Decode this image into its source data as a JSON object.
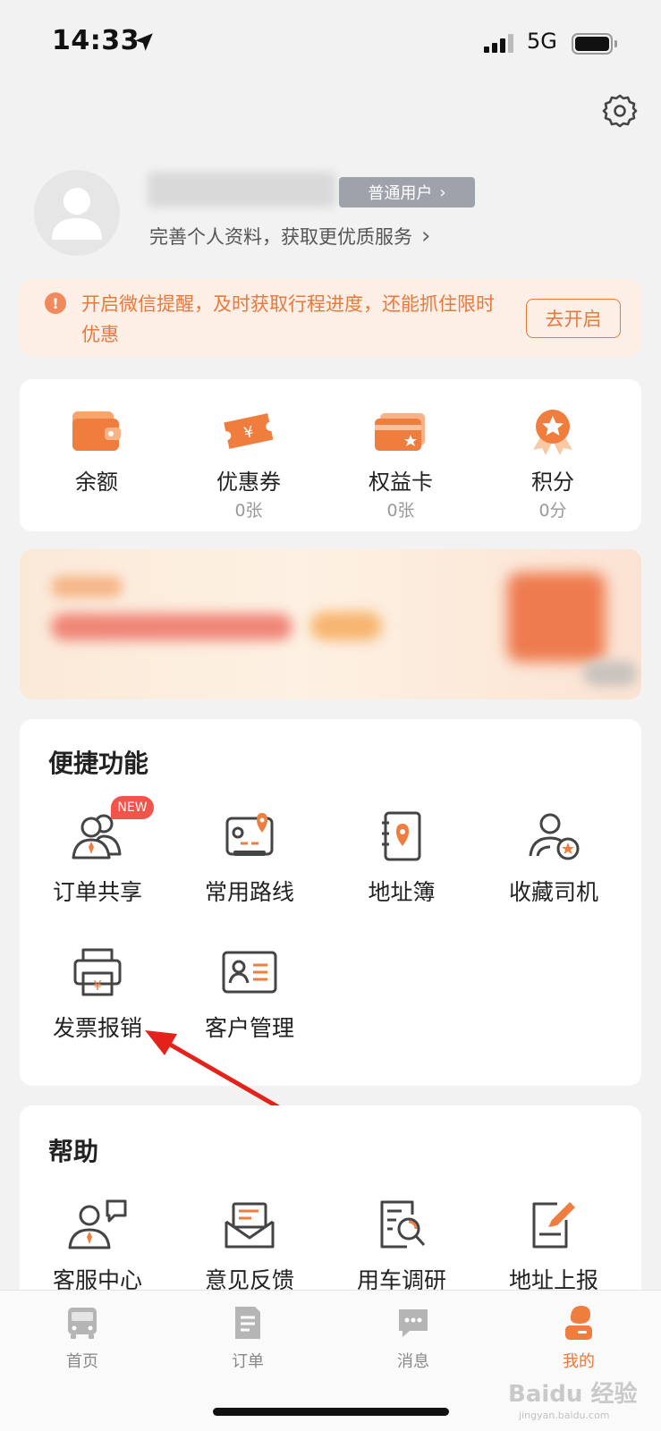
{
  "status_bar": {
    "time": "14:33",
    "network": "5G"
  },
  "profile": {
    "user_tag": "普通用户",
    "subtitle": "完善个人资料，获取更优质服务"
  },
  "notice": {
    "text": "开启微信提醒，及时获取行程进度，还能抓住限时优惠",
    "button": "去开启"
  },
  "assets": [
    {
      "label": "余额",
      "count": "",
      "icon": "wallet-icon"
    },
    {
      "label": "优惠券",
      "count": "0张",
      "icon": "coupon-icon"
    },
    {
      "label": "权益卡",
      "count": "0张",
      "icon": "benefit-card-icon"
    },
    {
      "label": "积分",
      "count": "0分",
      "icon": "points-medal-icon"
    }
  ],
  "quick": {
    "title": "便捷功能",
    "new_badge": "NEW",
    "items": [
      {
        "label": "订单共享",
        "icon": "order-share-icon"
      },
      {
        "label": "常用路线",
        "icon": "route-map-icon"
      },
      {
        "label": "地址簿",
        "icon": "address-book-icon"
      },
      {
        "label": "收藏司机",
        "icon": "favorite-driver-icon"
      },
      {
        "label": "发票报销",
        "icon": "invoice-printer-icon"
      },
      {
        "label": "客户管理",
        "icon": "customer-card-icon"
      }
    ]
  },
  "help": {
    "title": "帮助",
    "items": [
      {
        "label": "客服中心",
        "icon": "customer-service-icon"
      },
      {
        "label": "意见反馈",
        "icon": "feedback-icon"
      },
      {
        "label": "用车调研",
        "icon": "survey-icon"
      },
      {
        "label": "地址上报",
        "icon": "address-report-icon"
      }
    ]
  },
  "tabs": [
    {
      "label": "首页",
      "icon": "truck-icon",
      "active": false
    },
    {
      "label": "订单",
      "icon": "order-list-icon",
      "active": false
    },
    {
      "label": "消息",
      "icon": "message-icon",
      "active": false
    },
    {
      "label": "我的",
      "icon": "profile-icon",
      "active": true
    }
  ],
  "watermark": {
    "text": "Baidu 经验",
    "sub": "jingyan.baidu.com"
  },
  "colors": {
    "accent": "#e8793c",
    "annotation_arrow": "#e3221c"
  }
}
